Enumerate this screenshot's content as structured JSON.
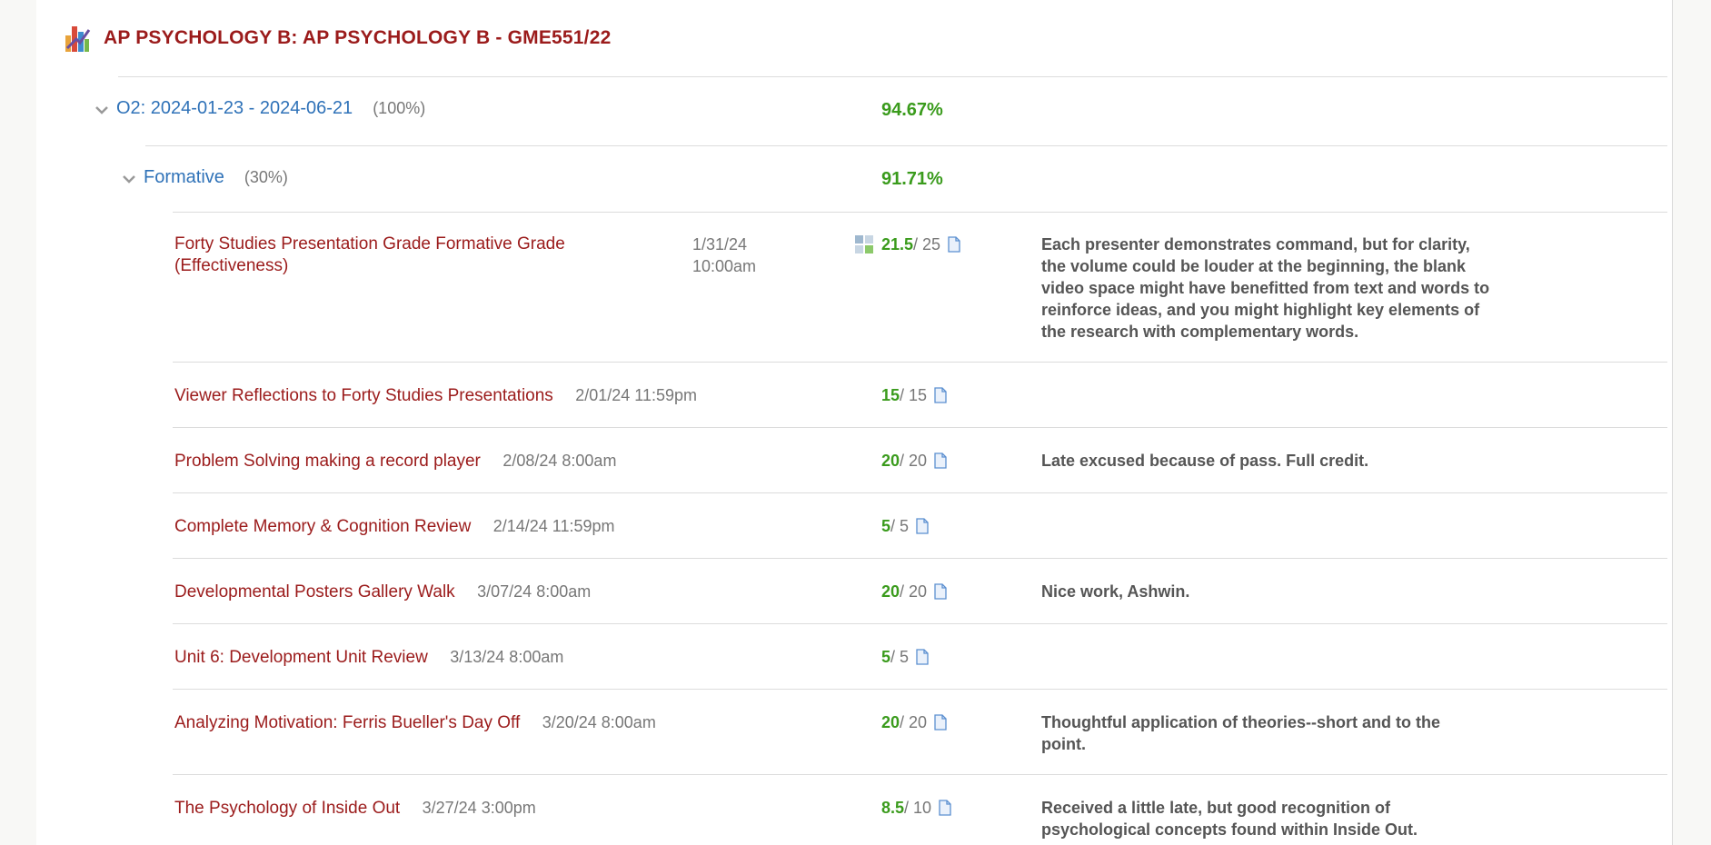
{
  "course": {
    "title": "AP PSYCHOLOGY B: AP PSYCHOLOGY B - GME551/22",
    "icon": "grade-chart-icon"
  },
  "period": {
    "title": "O2: 2024-01-23 - 2024-06-21",
    "weight": "(100%)",
    "grade": "94.67%"
  },
  "category": {
    "title": "Formative",
    "weight": "(30%)",
    "grade": "91.71%"
  },
  "items": [
    {
      "title": "Forty Studies Presentation Grade Formative Grade (Effectiveness)",
      "date": "1/31/24 10:00am",
      "earned": "21.5",
      "possible": "/ 25",
      "comment": "Each presenter demonstrates command, but for clarity, the volume could be louder at the beginning, the blank video space might have benefitted from text and words to reinforce ideas, and you might highlight key elements of the research with complementary words.",
      "rubric": true
    },
    {
      "title": "Viewer Reflections to Forty Studies Presentations",
      "date": "2/01/24 11:59pm",
      "earned": "15",
      "possible": "/ 15",
      "comment": ""
    },
    {
      "title": "Problem Solving making a record player",
      "date": "2/08/24 8:00am",
      "earned": "20",
      "possible": "/ 20",
      "comment": "Late excused because of pass. Full credit."
    },
    {
      "title": "Complete Memory & Cognition Review",
      "date": "2/14/24 11:59pm",
      "earned": "5",
      "possible": "/ 5",
      "comment": ""
    },
    {
      "title": "Developmental Posters Gallery Walk",
      "date": "3/07/24 8:00am",
      "earned": "20",
      "possible": "/ 20",
      "comment": "Nice work, Ashwin."
    },
    {
      "title": "Unit 6: Development Unit Review",
      "date": "3/13/24 8:00am",
      "earned": "5",
      "possible": "/ 5",
      "comment": ""
    },
    {
      "title": "Analyzing Motivation: Ferris Bueller's Day Off",
      "date": "3/20/24 8:00am",
      "earned": "20",
      "possible": "/ 20",
      "comment": "Thoughtful application of theories--short and to the point."
    },
    {
      "title": "The Psychology of Inside Out",
      "date": "3/27/24 3:00pm",
      "earned": "8.5",
      "possible": "/ 10",
      "comment": "Received a little late, but good recognition of psychological concepts found within Inside Out."
    }
  ],
  "colors": {
    "course_title": "#9b1b1b",
    "period_title": "#2f72b8",
    "grade_green": "#3a9b1c",
    "muted": "#777777"
  }
}
